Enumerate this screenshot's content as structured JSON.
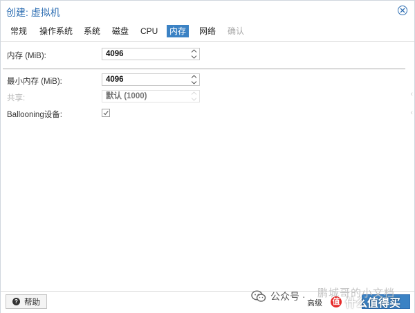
{
  "dialog": {
    "title": "创建: 虚拟机"
  },
  "tabs": [
    {
      "label": "常规",
      "state": "normal"
    },
    {
      "label": "操作系统",
      "state": "normal"
    },
    {
      "label": "系统",
      "state": "normal"
    },
    {
      "label": "磁盘",
      "state": "normal"
    },
    {
      "label": "CPU",
      "state": "normal"
    },
    {
      "label": "内存",
      "state": "active"
    },
    {
      "label": "网络",
      "state": "normal"
    },
    {
      "label": "确认",
      "state": "disabled"
    }
  ],
  "form": {
    "memory": {
      "label": "内存 (MiB):",
      "value": "4096"
    },
    "min_memory": {
      "label": "最小内存 (MiB):",
      "value": "4096"
    },
    "shares": {
      "label": "共享:",
      "placeholder": "默认 (1000)"
    },
    "ballooning": {
      "label": "Ballooning设备:",
      "checked": true
    }
  },
  "footer": {
    "help_label": "帮助",
    "advanced_label": "高级"
  },
  "watermark": {
    "wechat_text": "公众号 ·",
    "faded_text": "鹏城哥的小文档",
    "smzdm_icon": "值",
    "smzdm_text": "什么值得买"
  },
  "colors": {
    "accent": "#3b82c4",
    "title": "#2f6fb3"
  }
}
